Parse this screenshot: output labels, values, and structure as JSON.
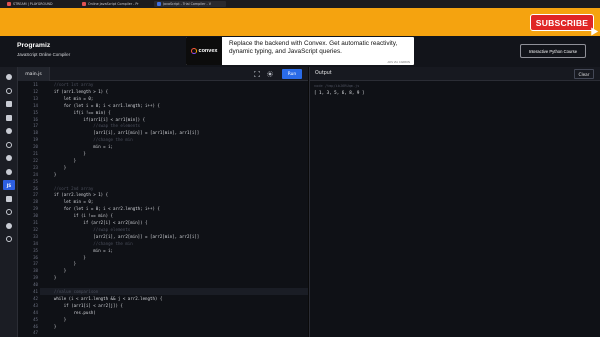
{
  "browser": {
    "tabs": [
      {
        "label": "STREAM | PLAYGROUND",
        "color": "#e05252"
      },
      {
        "label": "Online JavaScript Compiler - Pr",
        "color": "#e05252"
      },
      {
        "label": "JavaScript - Trial Compiler - V",
        "color": "#3f6fe0"
      }
    ]
  },
  "banner": {
    "subscribe_label": "SUBSCRIBE",
    "accent_color": "#f5a30f"
  },
  "header": {
    "logo": "Programiz",
    "subtitle": "JavaScript Online Compiler",
    "ad": {
      "brand": "convex",
      "text": "Replace the backend with Convex. Get automatic reactivity, dynamic typing, and JavaScript queries.",
      "via": "ADS VIA CARBON"
    },
    "course_button": "Interactive Python Course"
  },
  "sidebar": {
    "items": [
      {
        "icon": "python-icon"
      },
      {
        "icon": "r-icon"
      },
      {
        "icon": "sql-icon"
      },
      {
        "icon": "html-icon"
      },
      {
        "icon": "java-icon"
      },
      {
        "icon": "c-icon"
      },
      {
        "icon": "cpp-icon"
      },
      {
        "icon": "csharp-icon"
      },
      {
        "icon": "js-icon",
        "label": "JS",
        "active": true
      },
      {
        "icon": "go-icon"
      },
      {
        "icon": "php-icon"
      },
      {
        "icon": "swift-icon"
      },
      {
        "icon": "rust-icon"
      }
    ]
  },
  "editor": {
    "file_tab": "main.js",
    "run_label": "Run",
    "current_line": 41,
    "lines": [
      {
        "n": "11",
        "t": "    //sort 1st array",
        "c": true
      },
      {
        "n": "12",
        "t": "    if (arr1.length > 1) {"
      },
      {
        "n": "13",
        "t": "        let min = 0;"
      },
      {
        "n": "14",
        "t": "        for (let i = 0; i < arr1.length; i++) {"
      },
      {
        "n": "15",
        "t": "            if(i !== min) {"
      },
      {
        "n": "16",
        "t": "                if(arr1[i] < arr1[min]) {"
      },
      {
        "n": "17",
        "t": "                    //swap the elements",
        "c": true
      },
      {
        "n": "18",
        "t": "                    [arr1[i], arr1[min]] = [arr1[min], arr1[i]]"
      },
      {
        "n": "19",
        "t": "                    //change the min",
        "c": true
      },
      {
        "n": "20",
        "t": "                    min = i;"
      },
      {
        "n": "21",
        "t": "                }"
      },
      {
        "n": "22",
        "t": "            }"
      },
      {
        "n": "23",
        "t": "        }"
      },
      {
        "n": "24",
        "t": "    }"
      },
      {
        "n": "25",
        "t": ""
      },
      {
        "n": "26",
        "t": "    //sort 2nd array",
        "c": true
      },
      {
        "n": "27",
        "t": "    if (arr2.length > 1) {"
      },
      {
        "n": "28",
        "t": "        let min = 0;"
      },
      {
        "n": "29",
        "t": "        for (let i = 0; i < arr2.length; i++) {"
      },
      {
        "n": "30",
        "t": "            if (i !== min) {"
      },
      {
        "n": "31",
        "t": "                if (arr2[i] < arr2[min]) {"
      },
      {
        "n": "32",
        "t": "                    //swap elements",
        "c": true
      },
      {
        "n": "33",
        "t": "                    [arr2[i], arr2[min]] = [arr2[min], arr2[i]]"
      },
      {
        "n": "34",
        "t": "                    //change the min",
        "c": true
      },
      {
        "n": "35",
        "t": "                    min = i;"
      },
      {
        "n": "36",
        "t": "                }"
      },
      {
        "n": "37",
        "t": "            }"
      },
      {
        "n": "38",
        "t": "        }"
      },
      {
        "n": "39",
        "t": "    }"
      },
      {
        "n": "40",
        "t": ""
      },
      {
        "n": "41",
        "t": "    //value comparison",
        "c": true
      },
      {
        "n": "42",
        "t": "    while (i < arr1.length && j < arr2.length) {"
      },
      {
        "n": "43",
        "t": "        if (arr1[i] < arr2[j]) {"
      },
      {
        "n": "44",
        "t": "            res.push("
      },
      {
        "n": "45",
        "t": "        }"
      },
      {
        "n": "46",
        "t": "    }"
      },
      {
        "n": "47",
        "t": ""
      }
    ]
  },
  "output": {
    "title": "Output",
    "clear_label": "Clear",
    "command": "node /tmp/ibJ6RUqm.js",
    "result": "[ 1, 3, 5, 6, 8, 9 ]"
  }
}
